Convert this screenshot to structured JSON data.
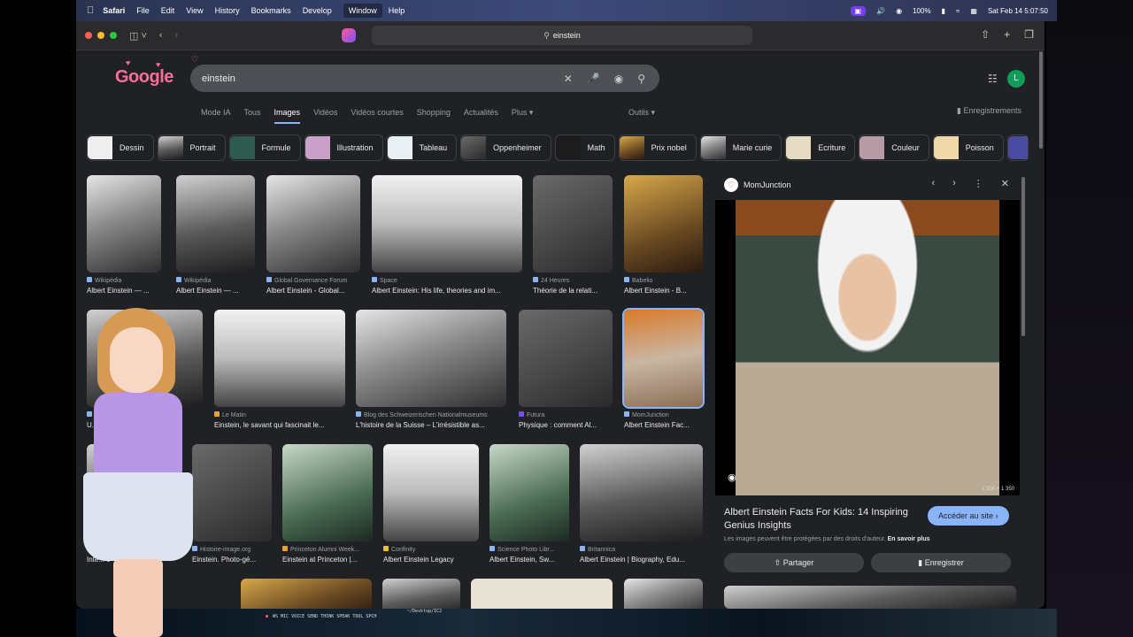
{
  "menubar": {
    "app": "Safari",
    "items": [
      "File",
      "Edit",
      "View",
      "History",
      "Bookmarks",
      "Develop",
      "Window",
      "Help"
    ],
    "battery": "100%",
    "datetime": "Sat Feb 14  5:07:50"
  },
  "browser": {
    "address": "einstein"
  },
  "google": {
    "logo": "Google",
    "query": "einstein",
    "avatar_letter": "L",
    "tabs": [
      "Mode IA",
      "Tous",
      "Images",
      "Vidéos",
      "Vidéos courtes",
      "Shopping",
      "Actualités",
      "Plus"
    ],
    "active_tab": "Images",
    "tools": "Outils",
    "saved": "Enregistrements"
  },
  "chips": [
    "Dessin",
    "Portrait",
    "Formule",
    "Illustration",
    "Tableau",
    "Oppenheimer",
    "Math",
    "Prix nobel",
    "Marie curie",
    "Ecriture",
    "Couleur",
    "Poisson"
  ],
  "results": [
    {
      "source": "Wikipédia",
      "title": "Albert Einstein — ..."
    },
    {
      "source": "Wikipédia",
      "title": "Albert Einstein — ..."
    },
    {
      "source": "Global Governance Forum",
      "title": "Albert Einstein - Global..."
    },
    {
      "source": "Space",
      "title": "Albert Einstein: His life, theories and im..."
    },
    {
      "source": "24 Heures",
      "title": "Théorie de la relati..."
    },
    {
      "source": "Babelio",
      "title": "Albert Einstein - B..."
    },
    {
      "source": "",
      "title": "U...stei..."
    },
    {
      "source": "Le Matin",
      "title": "Einstein, le savant qui fascinait le..."
    },
    {
      "source": "Blog des Schweizerischen Nationalmuseums",
      "title": "L'histoire de la Suisse – L'irrésistible as..."
    },
    {
      "source": "Futura",
      "title": "Physique : comment Al..."
    },
    {
      "source": "MomJunction",
      "title": "Albert Einstein Fac..."
    },
    {
      "source": "",
      "title": "Inte... c"
    },
    {
      "source": "Histoire-image.org",
      "title": "Einstein. Photo-gé..."
    },
    {
      "source": "Princeton Alumni Week...",
      "title": "Einstein at Princeton |..."
    },
    {
      "source": "Confinity",
      "title": "Albert Einstein Legacy"
    },
    {
      "source": "Science Photo Libr...",
      "title": "Albert Einstein, Sw..."
    },
    {
      "source": "Britannica",
      "title": "Albert Einstein | Biography, Edu..."
    }
  ],
  "panel": {
    "source": "MomJunction",
    "dimensions": "1 200 × 1 350",
    "title": "Albert Einstein Facts For Kids: 14 Inspiring Genius Insights",
    "visit": "Accéder au site",
    "rights": "Les images peuvent être protégées par des droits d'auteur.",
    "learn_more": "En savoir plus",
    "share": "Partager",
    "save": "Enregistrer"
  },
  "terminal": {
    "path": "~/Desktop/IC2",
    "status": "WS  MIC  VOICE  SEND  THINK  SPEAK  TOOL  SPCH"
  },
  "colors": {
    "accent": "#8ab4f8",
    "background": "#202124",
    "avatar": "#0f9d58"
  }
}
